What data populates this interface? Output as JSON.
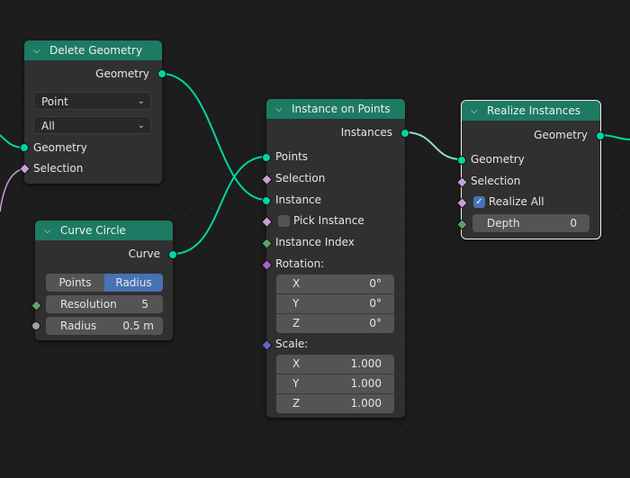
{
  "nodes": {
    "delete_geometry": {
      "title": "Delete Geometry",
      "output_geometry": "Geometry",
      "domain": "Point",
      "mode": "All",
      "input_geometry": "Geometry",
      "input_selection": "Selection"
    },
    "curve_circle": {
      "title": "Curve Circle",
      "output_curve": "Curve",
      "mode_points": "Points",
      "mode_radius": "Radius",
      "resolution_label": "Resolution",
      "resolution_value": "5",
      "radius_label": "Radius",
      "radius_value": "0.5 m"
    },
    "instance_on_points": {
      "title": "Instance on Points",
      "output_instances": "Instances",
      "input_points": "Points",
      "input_selection": "Selection",
      "input_instance": "Instance",
      "pick_instance": "Pick Instance",
      "instance_index": "Instance Index",
      "rotation_label": "Rotation:",
      "rotation": [
        {
          "axis": "X",
          "value": "0°"
        },
        {
          "axis": "Y",
          "value": "0°"
        },
        {
          "axis": "Z",
          "value": "0°"
        }
      ],
      "scale_label": "Scale:",
      "scale": [
        {
          "axis": "X",
          "value": "1.000"
        },
        {
          "axis": "Y",
          "value": "1.000"
        },
        {
          "axis": "Z",
          "value": "1.000"
        }
      ]
    },
    "realize_instances": {
      "title": "Realize Instances",
      "output_geometry": "Geometry",
      "input_geometry": "Geometry",
      "input_selection": "Selection",
      "realize_all": "Realize All",
      "depth_label": "Depth",
      "depth_value": "0"
    }
  },
  "colors": {
    "background": "#1d1d1d",
    "node_body": "#303030",
    "header_geometry": "#1d7a63",
    "geometry_socket": "#00d6a3",
    "field_socket": "#c9a0dd",
    "active_button": "#4772b3"
  }
}
